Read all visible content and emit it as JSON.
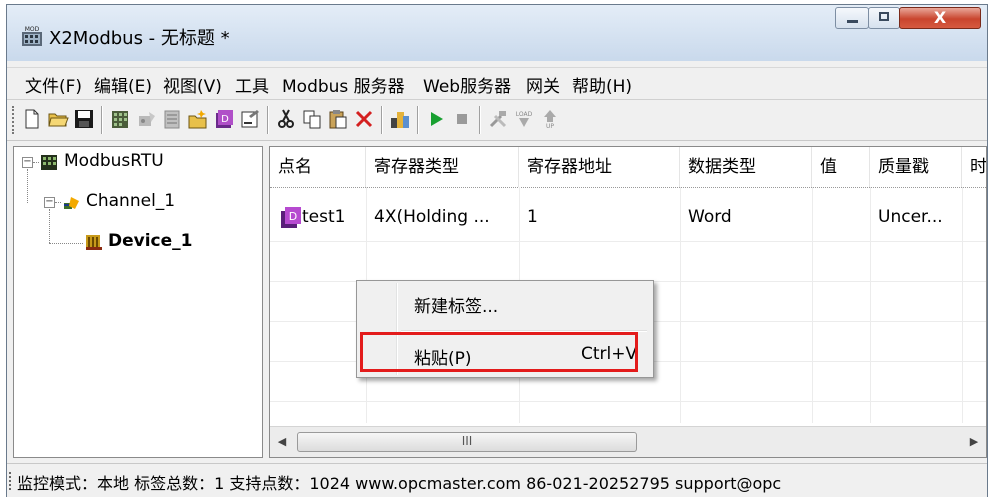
{
  "window": {
    "icon_text": "MOD",
    "title": "X2Modbus - 无标题 *",
    "close_glyph": "X"
  },
  "menubar": {
    "items": [
      "文件(F)",
      "编辑(E)",
      "视图(V)",
      "工具",
      "Modbus 服务器",
      "Web服务器",
      "网关",
      "帮助(H)"
    ]
  },
  "toolbar": {
    "buttons": [
      "new-file-icon",
      "open-folder-icon",
      "save-icon",
      "new-channel-icon",
      "new-device-icon",
      "device-properties-icon",
      "new-tag-icon",
      "tag-icon",
      "properties-icon",
      "cut-icon",
      "copy-icon",
      "paste-icon",
      "delete-icon",
      "quick-client-icon",
      "run-icon",
      "stop-icon",
      "tools-icon",
      "load-icon",
      "upload-icon"
    ]
  },
  "tree": {
    "root": "ModbusRTU",
    "channel": "Channel_1",
    "device": "Device_1"
  },
  "list": {
    "columns": [
      "点名",
      "寄存器类型",
      "寄存器地址",
      "数据类型",
      "值",
      "质量戳",
      "时间"
    ],
    "rows": [
      [
        "test1",
        "4X(Holding ...",
        "1",
        "Word",
        "",
        "Uncer...",
        ""
      ]
    ],
    "scroll_thumb_glyph": "III"
  },
  "context_menu": {
    "new_tag": "新建标签...",
    "paste": "粘贴(P)",
    "paste_shortcut": "Ctrl+V"
  },
  "statusbar": {
    "text": "监控模式：本地  标签总数：1  支持点数：1024  www.opcmaster.com 86-021-20252795 support@opc"
  },
  "colors": {
    "highlight_box": "#e31b1b",
    "titlebar_top": "#e4edf7",
    "close_button": "#c9452e"
  }
}
